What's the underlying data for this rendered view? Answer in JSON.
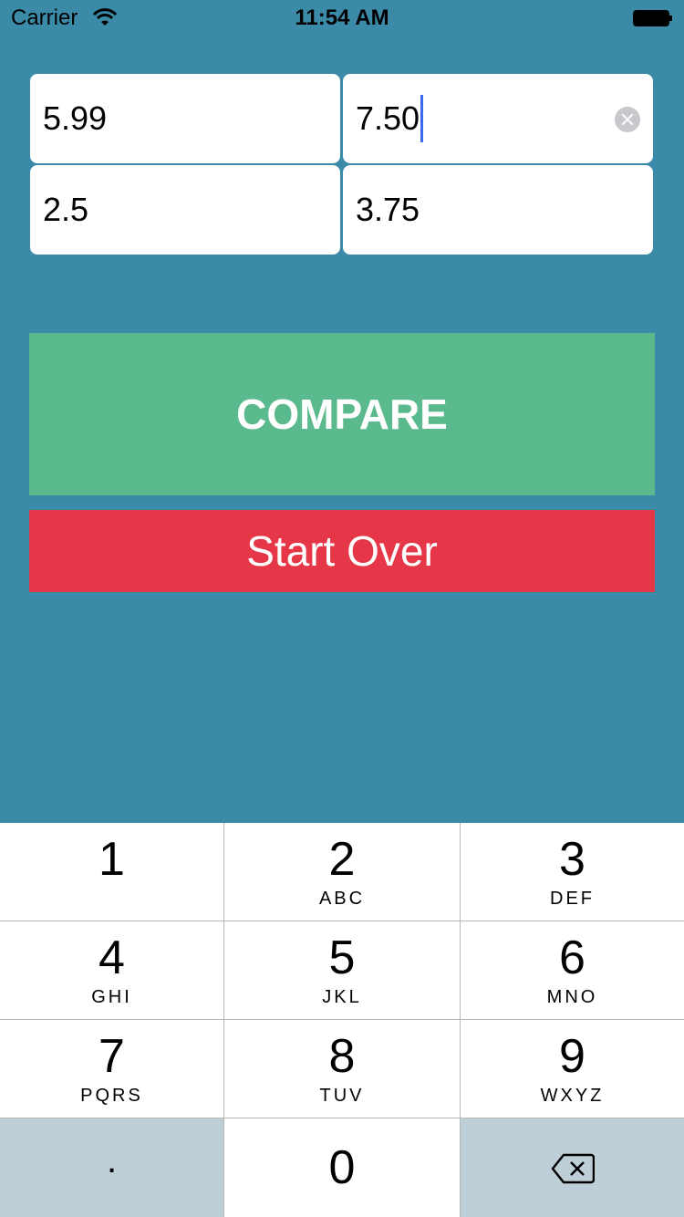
{
  "status_bar": {
    "carrier": "Carrier",
    "time": "11:54 AM"
  },
  "fields": {
    "price_a": "5.99",
    "price_b": "7.50",
    "size_a": "2.5",
    "size_b": "3.75"
  },
  "buttons": {
    "compare": "COMPARE",
    "start_over": "Start Over"
  },
  "colors": {
    "background": "#3a8aa8",
    "compare": "#5bba8d",
    "start_over": "#e53747",
    "keypad_gray": "#bfcfd8"
  },
  "keypad": {
    "keys": [
      {
        "digit": "1",
        "letters": ""
      },
      {
        "digit": "2",
        "letters": "ABC"
      },
      {
        "digit": "3",
        "letters": "DEF"
      },
      {
        "digit": "4",
        "letters": "GHI"
      },
      {
        "digit": "5",
        "letters": "JKL"
      },
      {
        "digit": "6",
        "letters": "MNO"
      },
      {
        "digit": "7",
        "letters": "PQRS"
      },
      {
        "digit": "8",
        "letters": "TUV"
      },
      {
        "digit": "9",
        "letters": "WXYZ"
      }
    ],
    "decimal": ".",
    "zero": "0"
  }
}
